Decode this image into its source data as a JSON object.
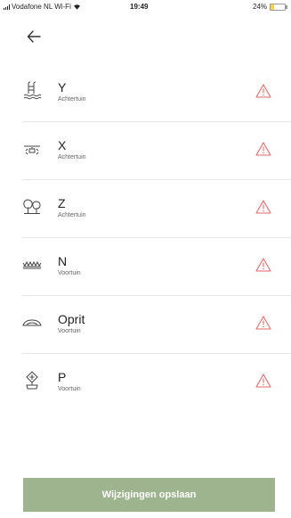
{
  "status_bar": {
    "carrier": "Vodafone NL Wi-Fi",
    "time": "19:49",
    "battery": "24%",
    "battery_fraction": 0.24,
    "icons": [
      "signal-icon",
      "wifi-icon",
      "battery-icon"
    ]
  },
  "header": {
    "back_icon": "arrow-left-icon"
  },
  "items": [
    {
      "title": "Y",
      "subtitle": "Achtertuin",
      "icon": "pool-icon",
      "status_icon": "warning-icon"
    },
    {
      "title": "X",
      "subtitle": "Achtertuin",
      "icon": "sprinkler-icon",
      "status_icon": "warning-icon"
    },
    {
      "title": "Z",
      "subtitle": "Achtertuin",
      "icon": "trees-icon",
      "status_icon": "warning-icon"
    },
    {
      "title": "N",
      "subtitle": "Voortuin",
      "icon": "lawn-icon",
      "status_icon": "warning-icon"
    },
    {
      "title": "Oprit",
      "subtitle": "Voortuin",
      "icon": "driveway-icon",
      "status_icon": "warning-icon"
    },
    {
      "title": "P",
      "subtitle": "Voortuin",
      "icon": "plant-icon",
      "status_icon": "warning-icon"
    }
  ],
  "footer": {
    "save_label": "Wijzigingen opslaan"
  },
  "colors": {
    "warning": "#e36a6a",
    "button": "#9db48f",
    "battery": "#f2d34a",
    "divider": "#e6e6e6"
  }
}
